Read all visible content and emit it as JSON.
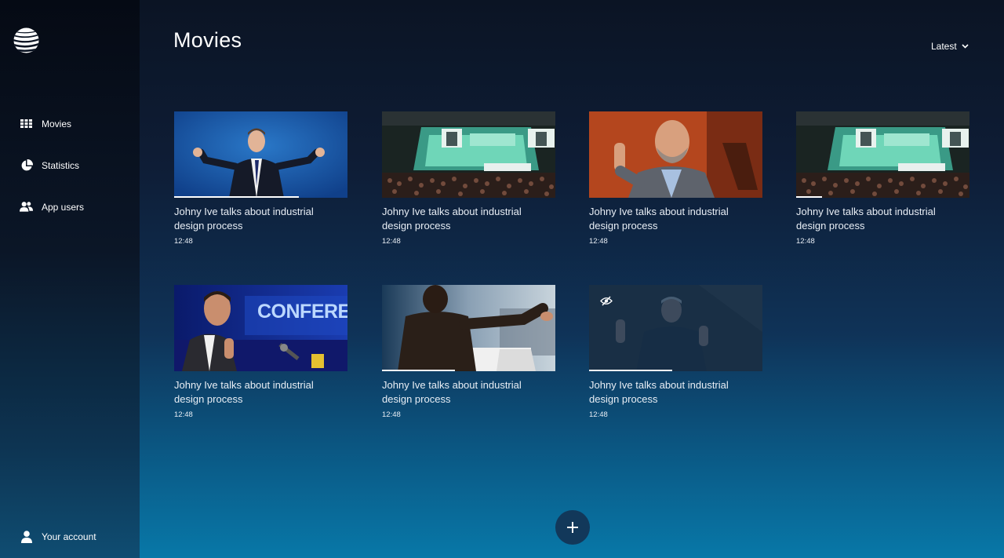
{
  "sidebar": {
    "items": [
      {
        "label": "Movies",
        "icon": "grid-icon"
      },
      {
        "label": "Statistics",
        "icon": "pie-chart-icon"
      },
      {
        "label": "App users",
        "icon": "users-icon"
      }
    ],
    "account_label": "Your account"
  },
  "header": {
    "title": "Movies",
    "sort_label": "Latest"
  },
  "movies": [
    {
      "title": "Johny Ive talks about industrial design process",
      "duration": "12:48",
      "progress": 0.72,
      "hidden": false
    },
    {
      "title": "Johny Ive talks about industrial design process",
      "duration": "12:48",
      "progress": 0,
      "hidden": false
    },
    {
      "title": "Johny Ive talks about industrial design process",
      "duration": "12:48",
      "progress": 0,
      "hidden": false
    },
    {
      "title": "Johny Ive talks about industrial design process",
      "duration": "12:48",
      "progress": 0.15,
      "hidden": false
    },
    {
      "title": "Johny Ive talks about industrial design process",
      "duration": "12:48",
      "progress": 0,
      "hidden": false
    },
    {
      "title": "Johny Ive talks about industrial design process",
      "duration": "12:48",
      "progress": 0.42,
      "hidden": false
    },
    {
      "title": "Johny Ive talks about industrial design process",
      "duration": "12:48",
      "progress": 0.48,
      "hidden": true
    }
  ],
  "colors": {
    "accent": "#12385a",
    "background_top": "#0b1424",
    "background_bottom": "#0878a8"
  }
}
